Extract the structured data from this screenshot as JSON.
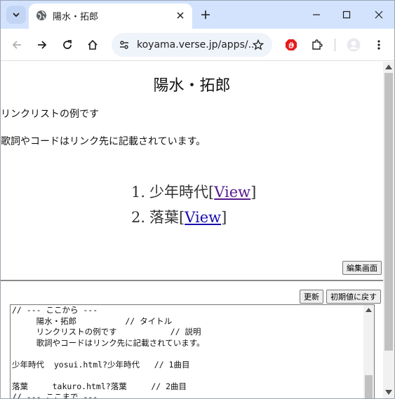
{
  "browser": {
    "tab_title": "陽水・拓郎",
    "url": "koyama.verse.jp/apps/...",
    "accent_color": "#d3e3fd"
  },
  "page": {
    "title": "陽水・拓郎",
    "description": "リンクリストの例です",
    "note": "歌詞やコードはリンク先に記載されています。",
    "songs": [
      {
        "number": "1.",
        "title": "少年時代",
        "bracket_open": "[",
        "link_text": "View",
        "bracket_close": "]"
      },
      {
        "number": "2.",
        "title": "落葉",
        "bracket_open": "[",
        "link_text": "View",
        "bracket_close": "]"
      }
    ],
    "edit_button": "編集画面",
    "update_button": "更新",
    "reset_button": "初期値に戻す"
  },
  "editor": {
    "lines": [
      "// --- ここから ---",
      "     陽水・拓郎          // タイトル",
      "     リンクリストの例です           // 説明",
      "     歌詞やコードはリンク先に記載されています。",
      "",
      "少年時代  yosui.html?少年時代   // 1曲目",
      "",
      "落葉     takuro.html?落葉     // 2曲目",
      "// --- ここまで ---"
    ]
  }
}
